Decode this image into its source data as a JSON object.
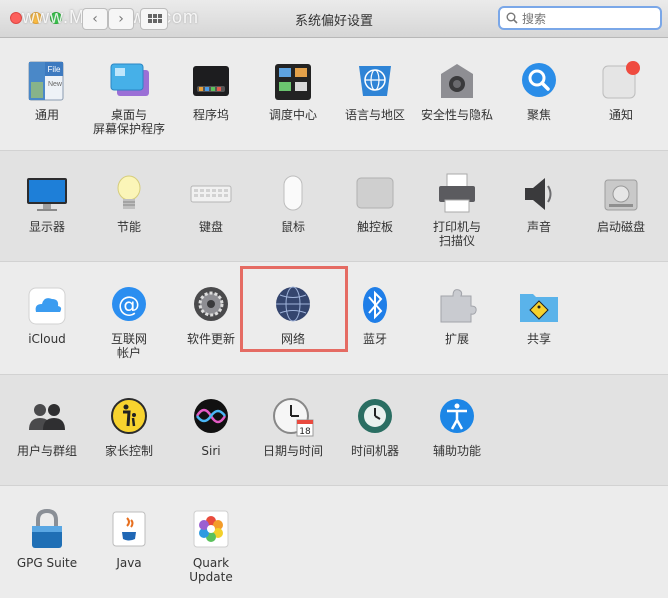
{
  "window": {
    "title": "系统偏好设置",
    "watermark": "www.MacDown.com"
  },
  "toolbar": {
    "back": "‹",
    "forward": "›",
    "search_placeholder": "搜索",
    "search_value": ""
  },
  "sections": [
    {
      "items": [
        {
          "label": "通用",
          "icon": "general-icon"
        },
        {
          "label": "桌面与\n屏幕保护程序",
          "icon": "desktop-screensaver-icon"
        },
        {
          "label": "程序坞",
          "icon": "dock-icon"
        },
        {
          "label": "调度中心",
          "icon": "mission-control-icon"
        },
        {
          "label": "语言与地区",
          "icon": "language-region-icon"
        },
        {
          "label": "安全性与隐私",
          "icon": "security-privacy-icon"
        },
        {
          "label": "聚焦",
          "icon": "spotlight-icon"
        },
        {
          "label": "通知",
          "icon": "notifications-icon"
        }
      ]
    },
    {
      "items": [
        {
          "label": "显示器",
          "icon": "displays-icon"
        },
        {
          "label": "节能",
          "icon": "energy-saver-icon"
        },
        {
          "label": "键盘",
          "icon": "keyboard-icon"
        },
        {
          "label": "鼠标",
          "icon": "mouse-icon"
        },
        {
          "label": "触控板",
          "icon": "trackpad-icon"
        },
        {
          "label": "打印机与\n扫描仪",
          "icon": "printers-scanners-icon"
        },
        {
          "label": "声音",
          "icon": "sound-icon"
        },
        {
          "label": "启动磁盘",
          "icon": "startup-disk-icon"
        }
      ]
    },
    {
      "items": [
        {
          "label": "iCloud",
          "icon": "icloud-icon"
        },
        {
          "label": "互联网\n帐户",
          "icon": "internet-accounts-icon"
        },
        {
          "label": "软件更新",
          "icon": "software-update-icon"
        },
        {
          "label": "网络",
          "icon": "network-icon"
        },
        {
          "label": "蓝牙",
          "icon": "bluetooth-icon"
        },
        {
          "label": "扩展",
          "icon": "extensions-icon"
        },
        {
          "label": "共享",
          "icon": "sharing-icon"
        }
      ]
    },
    {
      "items": [
        {
          "label": "用户与群组",
          "icon": "users-groups-icon"
        },
        {
          "label": "家长控制",
          "icon": "parental-controls-icon"
        },
        {
          "label": "Siri",
          "icon": "siri-icon"
        },
        {
          "label": "日期与时间",
          "icon": "date-time-icon"
        },
        {
          "label": "时间机器",
          "icon": "time-machine-icon"
        },
        {
          "label": "辅助功能",
          "icon": "accessibility-icon"
        }
      ]
    },
    {
      "items": [
        {
          "label": "GPG Suite",
          "icon": "gpg-suite-icon"
        },
        {
          "label": "Java",
          "icon": "java-icon"
        },
        {
          "label": "Quark\nUpdate",
          "icon": "quark-update-icon"
        }
      ]
    }
  ],
  "calendar_day": "18",
  "general_file_label": "File",
  "general_new_label": "New",
  "highlighted": "网络"
}
